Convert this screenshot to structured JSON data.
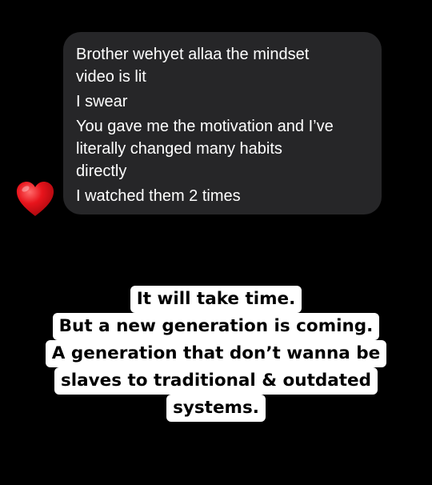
{
  "message": {
    "lines": [
      "Brother wehyet allaa the mindset",
      "video is lit",
      "I swear",
      "You gave me the motivation and I’ve",
      "literally changed many habits",
      "directly",
      "I watched them 2 times"
    ],
    "reaction_icon": "red-heart-icon",
    "bubble_color": "#262628"
  },
  "caption": {
    "lines": [
      "It will take time.",
      "But a new generation is coming.",
      "A generation that don’t wanna be",
      "slaves to traditional & outdated",
      "systems."
    ],
    "background_color": "#ffffff",
    "text_color": "#000000"
  },
  "background_color": "#000000"
}
